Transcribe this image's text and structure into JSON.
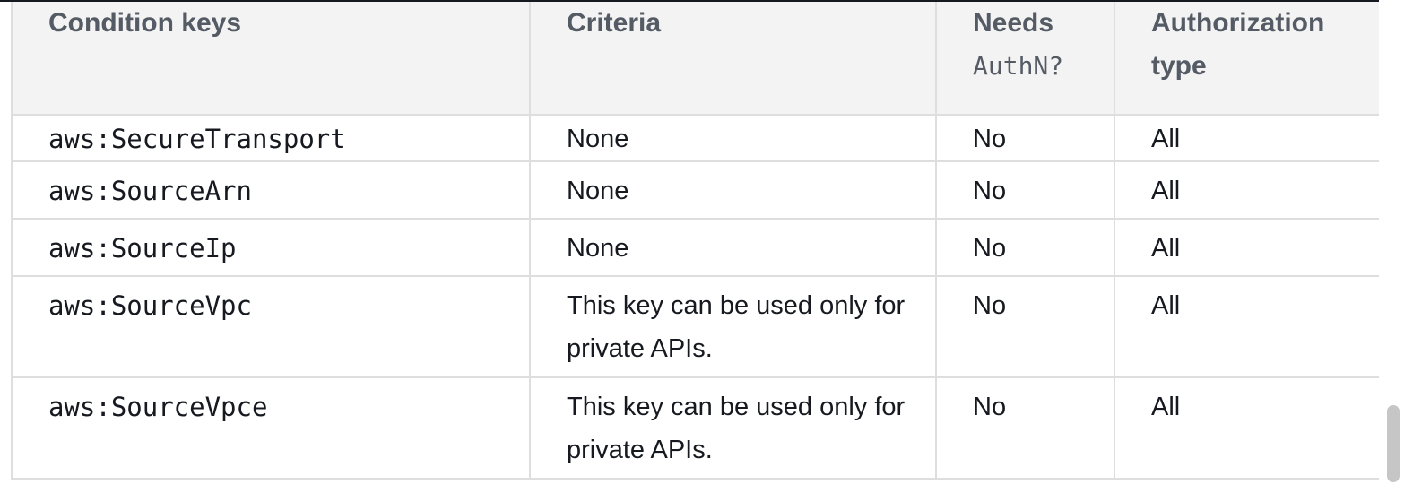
{
  "table": {
    "headers": {
      "condition_keys": "Condition keys",
      "criteria": "Criteria",
      "needs_authn_line1": "Needs",
      "needs_authn_line2": "AuthN?",
      "authorization_type": "Authorization type"
    },
    "rows": [
      {
        "key": "aws:SecureTransport",
        "criteria": "None",
        "needs_authn": "No",
        "authorization_type": "All"
      },
      {
        "key": "aws:SourceArn",
        "criteria": "None",
        "needs_authn": "No",
        "authorization_type": "All"
      },
      {
        "key": "aws:SourceIp",
        "criteria": "None",
        "needs_authn": "No",
        "authorization_type": "All"
      },
      {
        "key": "aws:SourceVpc",
        "criteria": "This key can be used only for private APIs.",
        "needs_authn": "No",
        "authorization_type": "All"
      },
      {
        "key": "aws:SourceVpce",
        "criteria": "This key can be used only for private APIs.",
        "needs_authn": "No",
        "authorization_type": "All"
      }
    ]
  }
}
